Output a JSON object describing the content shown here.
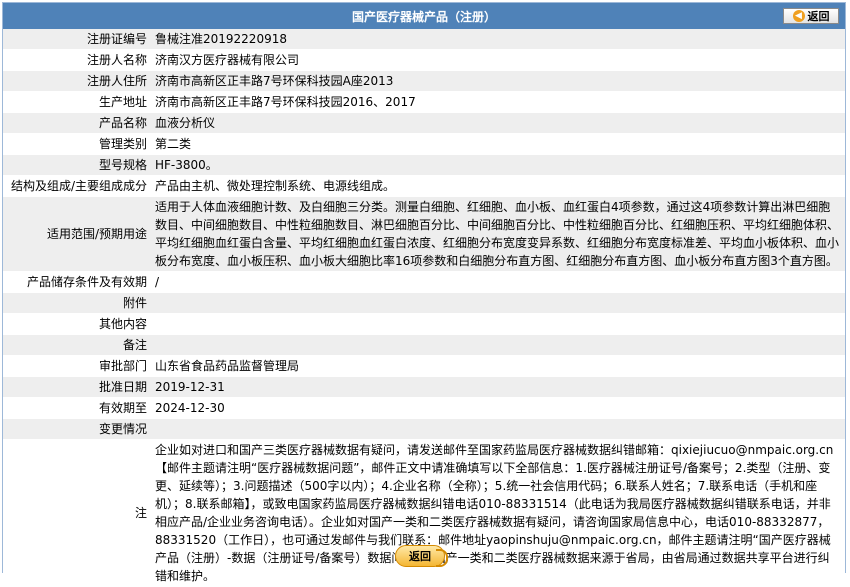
{
  "header": {
    "title": "国产医疗器械产品（注册）",
    "back_label": "返回"
  },
  "fields": [
    {
      "label": "注册证编号",
      "value": "鲁械注准20192220918"
    },
    {
      "label": "注册人名称",
      "value": "济南汉方医疗器械有限公司"
    },
    {
      "label": "注册人住所",
      "value": "济南市高新区正丰路7号环保科技园A座2013"
    },
    {
      "label": "生产地址",
      "value": "济南市高新区正丰路7号环保科技园2016、2017"
    },
    {
      "label": "产品名称",
      "value": "血液分析仪"
    },
    {
      "label": "管理类别",
      "value": "第二类"
    },
    {
      "label": "型号规格",
      "value": "HF-3800。"
    },
    {
      "label": "结构及组成/主要组成成分",
      "value": "产品由主机、微处理控制系统、电源线组成。"
    },
    {
      "label": "适用范围/预期用途",
      "value": "适用于人体血液细胞计数、及白细胞三分类。测量白细胞、红细胞、血小板、血红蛋白4项参数，通过这4项参数计算出淋巴细胞数目、中间细胞数目、中性粒细胞数目、淋巴细胞百分比、中间细胞百分比、中性粒细胞百分比、红细胞压积、平均红细胞体积、平均红细胞血红蛋白含量、平均红细胞血红蛋白浓度、红细胞分布宽度变异系数、红细胞分布宽度标准差、平均血小板体积、血小板分布宽度、血小板压积、血小板大细胞比率16项参数和白细胞分布直方图、红细胞分布直方图、血小板分布直方图3个直方图。"
    },
    {
      "label": "产品储存条件及有效期",
      "value": "/"
    },
    {
      "label": "附件",
      "value": ""
    },
    {
      "label": "其他内容",
      "value": ""
    },
    {
      "label": "备注",
      "value": ""
    },
    {
      "label": "审批部门",
      "value": "山东省食品药品监督管理局"
    },
    {
      "label": "批准日期",
      "value": "2019-12-31"
    },
    {
      "label": "有效期至",
      "value": "2024-12-30"
    },
    {
      "label": "变更情况",
      "value": ""
    }
  ],
  "note": {
    "label": "注",
    "text": "企业如对进口和国产三类医疗器械数据有疑问，请发送邮件至国家药监局医疗器械数据纠错邮箱：qixiejiucuo@nmpaic.org.cn【邮件主题请注明“医疗器械数据问题”，邮件正文中请准确填写以下全部信息：1.医疗器械注册证号/备案号；2.类型（注册、变更、延续等）；3.问题描述（500字以内）；4.企业名称（全称）；5.统一社会信用代码；6.联系人姓名；7.联系电话（手机和座机）；8.联系邮箱】，或致电国家药监局医疗器械数据纠错电话010-88331514（此电话为我局医疗器械数据纠错联系电话，并非相应产品/企业业务咨询电话）。企业如对国产一类和二类医疗器械数据有疑问，请咨询国家局信息中心，电话010-88332877，88331520（工作日），也可通过发邮件与我们联系：邮件地址yaopinshuju@nmpaic.org.cn，邮件主题请注明“国产医疗器械产品（注册）-数据（注册证号/备案号）数据问题”。国产一类和二类医疗器械数据来源于省局，由省局通过数据共享平台进行纠错和维护。"
  },
  "footer": {
    "back_label": "返回"
  }
}
